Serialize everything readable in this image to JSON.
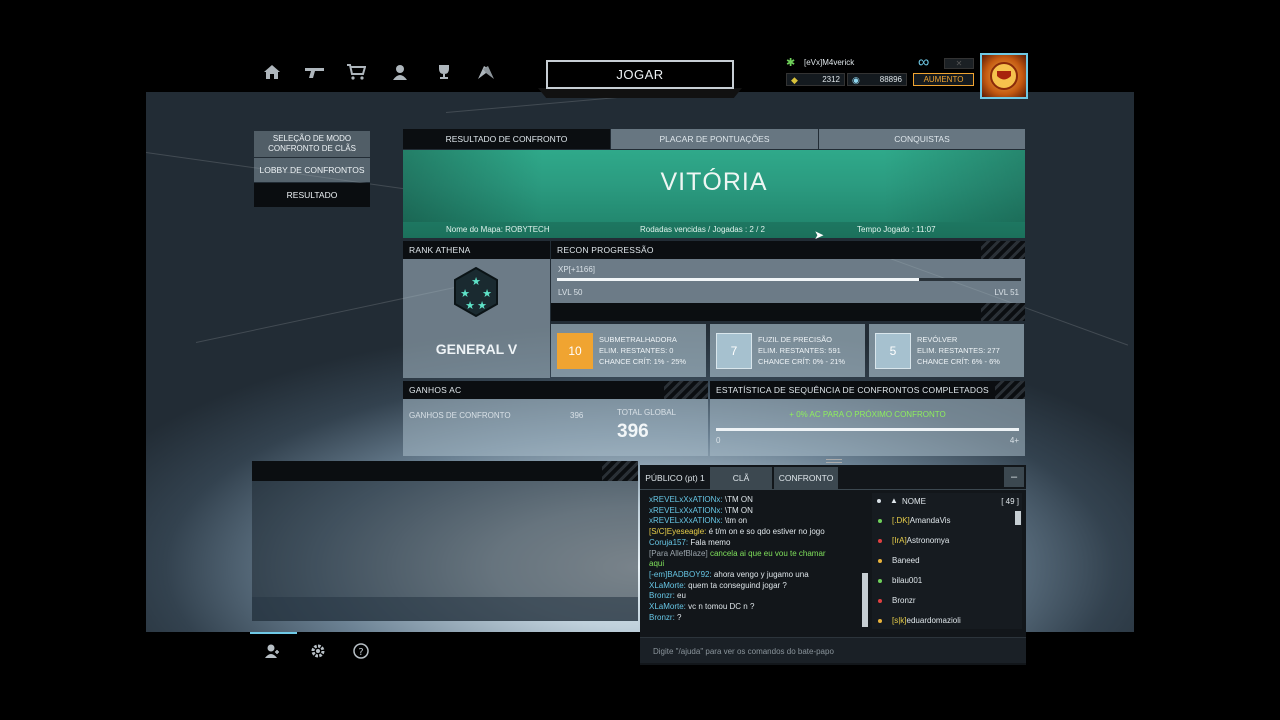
{
  "nav": {
    "icons": [
      "home-icon",
      "weapon-icon",
      "cart-icon",
      "profile-icon",
      "trophy-icon",
      "flags-icon"
    ],
    "play_label": "JOGAR"
  },
  "user": {
    "name": "[eVx]M4verick",
    "credits": "2312",
    "gems": "88896",
    "boost_label": "AUMENTO",
    "infinity": "∞"
  },
  "left_menu": {
    "mode_select": "SELEÇÃO DE MODO\nCONFRONTO DE CLÃS",
    "lobby": "LOBBY DE CONFRONTOS",
    "result": "RESULTADO"
  },
  "tabs": [
    "RESULTADO DE CONFRONTO",
    "PLACAR DE PONTUAÇÕES",
    "CONQUISTAS"
  ],
  "banner": {
    "title": "VITÓRIA",
    "map": "Nome do Mapa: ROBYTECH",
    "rounds": "Rodadas vencidas / Jogadas : 2 / 2",
    "time": "Tempo Jogado : 11:07"
  },
  "rank": {
    "header": "RANK ATHENA",
    "name": "GENERAL V"
  },
  "progress": {
    "header": "RECON PROGRESSÃO",
    "xp": "XP[+1166]",
    "level_from": "LVL 50",
    "level_to": "LVL 51",
    "fill": 0.78
  },
  "weapons": [
    {
      "level": "10",
      "name": "SUBMETRALHADORA",
      "elim": "ELIM. RESTANTES: 0",
      "crit": "CHANCE CRÍT: 1% - 25%",
      "color": "#f0a431"
    },
    {
      "level": "7",
      "name": "FUZIL DE PRECISÃO",
      "elim": "ELIM. RESTANTES: 591",
      "crit": "CHANCE CRÍT: 0% - 21%",
      "color": "#a6c1cf"
    },
    {
      "level": "5",
      "name": "REVÓLVER",
      "elim": "ELIM. RESTANTES: 277",
      "crit": "CHANCE CRÍT: 6% - 6%",
      "color": "#a6c1cf"
    }
  ],
  "ac": {
    "header": "GANHOS AC",
    "label": "GANHOS DE CONFRONTO",
    "value": "396",
    "total_label": "TOTAL GLOBAL",
    "total": "396"
  },
  "streak": {
    "header": "ESTATÍSTICA DE SEQUÊNCIA DE CONFRONTOS COMPLETADOS",
    "text": "+ 0% AC PARA O PRÓXIMO CONFRONTO",
    "min": "0",
    "max": "4+"
  },
  "chat": {
    "tabs": [
      "PÚBLICO (pt) 1",
      "CLÃ",
      "CONFRONTO"
    ],
    "minimize": "–",
    "messages": [
      {
        "who": "xREVELxXxATIONx:",
        "text": "\\TM ON",
        "wc": "cyan",
        "tc": ""
      },
      {
        "who": "xREVELxXxATIONx:",
        "text": "\\TM ON",
        "wc": "cyan",
        "tc": ""
      },
      {
        "who": "xREVELxXxATIONx:",
        "text": "\\tm on",
        "wc": "cyan",
        "tc": ""
      },
      {
        "who": "[S/C]Eyeseagle:",
        "text": "é t/m on e so qdo estiver no jogo",
        "wc": "yel",
        "tc": ""
      },
      {
        "who": "Coruja157:",
        "text": "Fala memo",
        "wc": "cyan",
        "tc": ""
      },
      {
        "who": "[Para AllefBlaze]",
        "text": "cancela ai que eu vou te chamar",
        "wc": "gry",
        "tc": "grn"
      },
      {
        "who": "",
        "text": "aqui",
        "wc": "",
        "tc": "grn"
      },
      {
        "who": "[-em]BADBOY92:",
        "text": "ahora vengo y jugamo una",
        "wc": "cyan",
        "tc": ""
      },
      {
        "who": "XLaMorte:",
        "text": "quem ta conseguind jogar ?",
        "wc": "cyan",
        "tc": ""
      },
      {
        "who": "Bronzr:",
        "text": "eu",
        "wc": "cyan",
        "tc": ""
      },
      {
        "who": "XLaMorte:",
        "text": "vc n tomou DC n ?",
        "wc": "cyan",
        "tc": ""
      },
      {
        "who": "Bronzr:",
        "text": "?",
        "wc": "cyan",
        "tc": ""
      }
    ],
    "list_header": "NOME",
    "count": "[ 49 ]",
    "players": [
      {
        "tag": "[.DK]",
        "name": "AmandaVis",
        "status": "#6fd05a"
      },
      {
        "tag": "[IrA]",
        "name": "Astronomya",
        "status": "#e04040"
      },
      {
        "tag": "",
        "name": "Baneed",
        "status": "#e9b23a"
      },
      {
        "tag": "",
        "name": "bilau001",
        "status": "#6fd05a"
      },
      {
        "tag": "",
        "name": "Bronzr",
        "status": "#e04040"
      },
      {
        "tag": "[s|k]",
        "name": "eduardomazioli",
        "status": "#e9b23a"
      }
    ],
    "input_placeholder": "Digite \"/ajuda\" para ver os comandos do bate-papo"
  },
  "bottom_icons": [
    "friends-icon",
    "settings-icon",
    "help-icon"
  ]
}
